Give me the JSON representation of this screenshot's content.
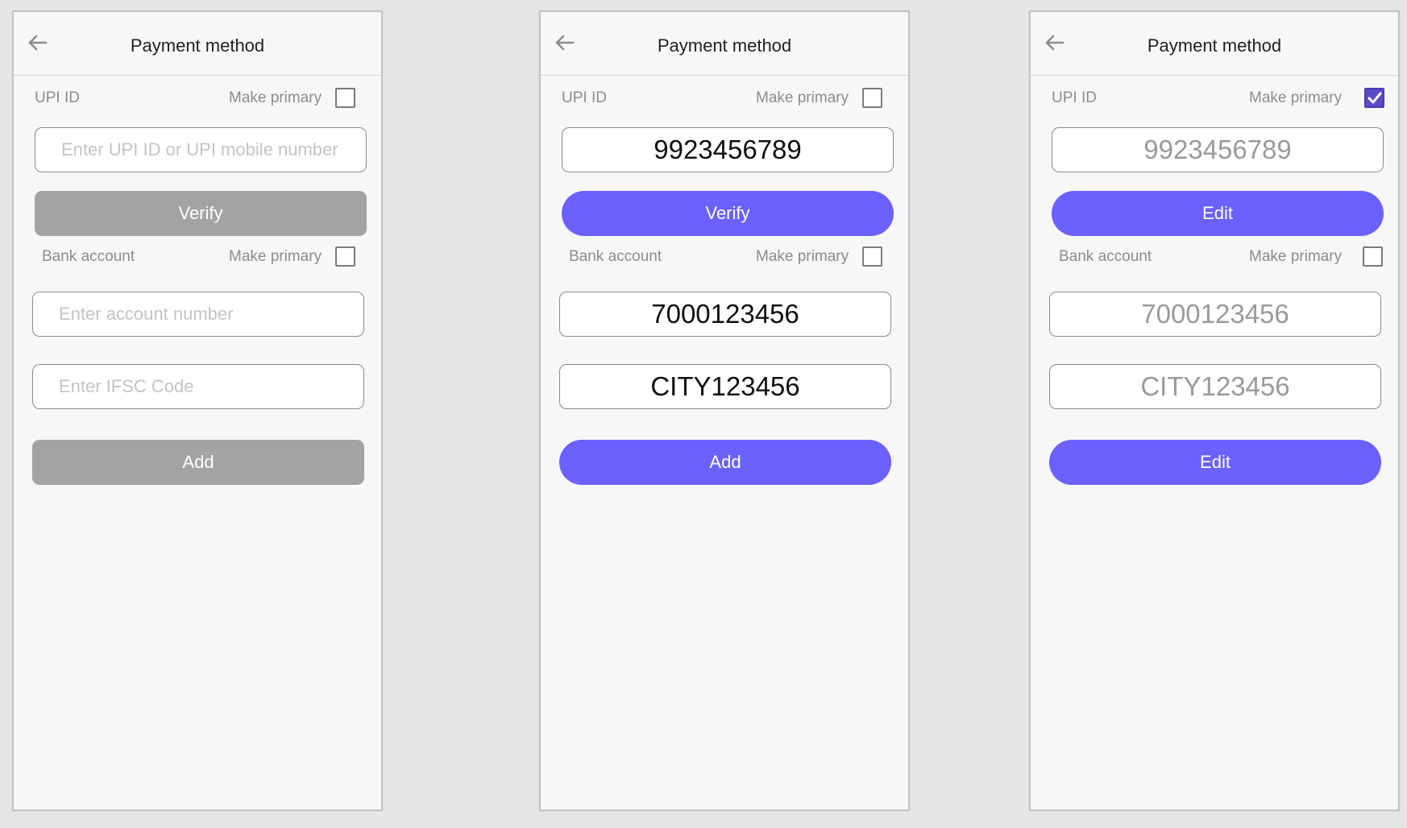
{
  "screens": [
    {
      "title": "Payment method",
      "upi_label": "UPI ID",
      "upi_primary_label": "Make primary",
      "upi_primary_checked": false,
      "upi_placeholder": "Enter UPI ID or UPI mobile number",
      "upi_value": "",
      "verify_label": "Verify",
      "bank_label": "Bank account",
      "bank_primary_label": "Make primary",
      "bank_primary_checked": false,
      "account_placeholder": "Enter account number",
      "account_value": "",
      "ifsc_placeholder": "Enter IFSC Code",
      "ifsc_value": "",
      "add_label": "Add"
    },
    {
      "title": "Payment method",
      "upi_label": "UPI ID",
      "upi_primary_label": "Make primary",
      "upi_primary_checked": false,
      "upi_value": "9923456789",
      "verify_label": "Verify",
      "bank_label": "Bank account",
      "bank_primary_label": "Make primary",
      "bank_primary_checked": false,
      "account_value": "7000123456",
      "ifsc_value": "CITY123456",
      "add_label": "Add"
    },
    {
      "title": "Payment method",
      "upi_label": "UPI ID",
      "upi_primary_label": "Make primary",
      "upi_primary_checked": true,
      "upi_value": "9923456789",
      "verify_label": "Edit",
      "bank_label": "Bank account",
      "bank_primary_label": "Make primary",
      "bank_primary_checked": false,
      "account_value": "7000123456",
      "ifsc_value": "CITY123456",
      "add_label": "Edit"
    }
  ],
  "colors": {
    "accent": "#6b61ff",
    "disabled": "#a3a3a3",
    "checked": "#5b4bc6"
  },
  "icons": {
    "back": "arrow-left-icon",
    "check": "checkmark-icon"
  }
}
